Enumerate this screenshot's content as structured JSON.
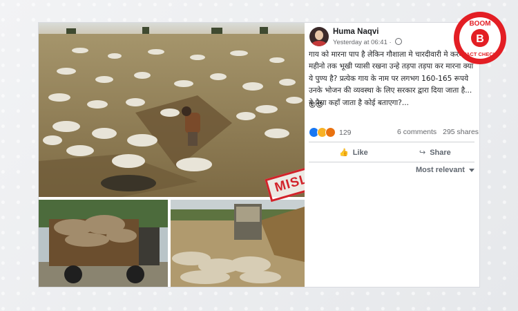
{
  "badge": {
    "stamp_text": "MISLEADING",
    "logo_top": "BOOM",
    "logo_letter": "B",
    "logo_bottom": "FACT CHECK"
  },
  "post": {
    "author": "Huma Naqvi",
    "timestamp": "Yesterday at 06:41 · ",
    "privacy_icon": "globe-icon",
    "text": "गाय को मारना पाप है लेकिन गौशाला मे चारदीवारी मे करके महीनो तक भूखी प्यासी रखना उन्हे तड़पा तड़पा कर मारना क्या ये पुण्य है? प्रत्येक गाय के नाम पर लगभग 160-165 रूपये उनके भोजन की व्यवस्था के लिए सरकार द्वारा दिया जाता है... ये पैसा कहाँ जाता है कोई बताएगा?...",
    "emoji_line": "😡😡",
    "reactions_count": "129",
    "comments": "6 comments",
    "shares": "295 shares",
    "like_label": "Like",
    "share_label": "Share",
    "sort_label": "Most relevant"
  },
  "colors": {
    "stamp": "#d2232a",
    "fb_blue": "#1877f2",
    "boom_red": "#e31e24"
  }
}
